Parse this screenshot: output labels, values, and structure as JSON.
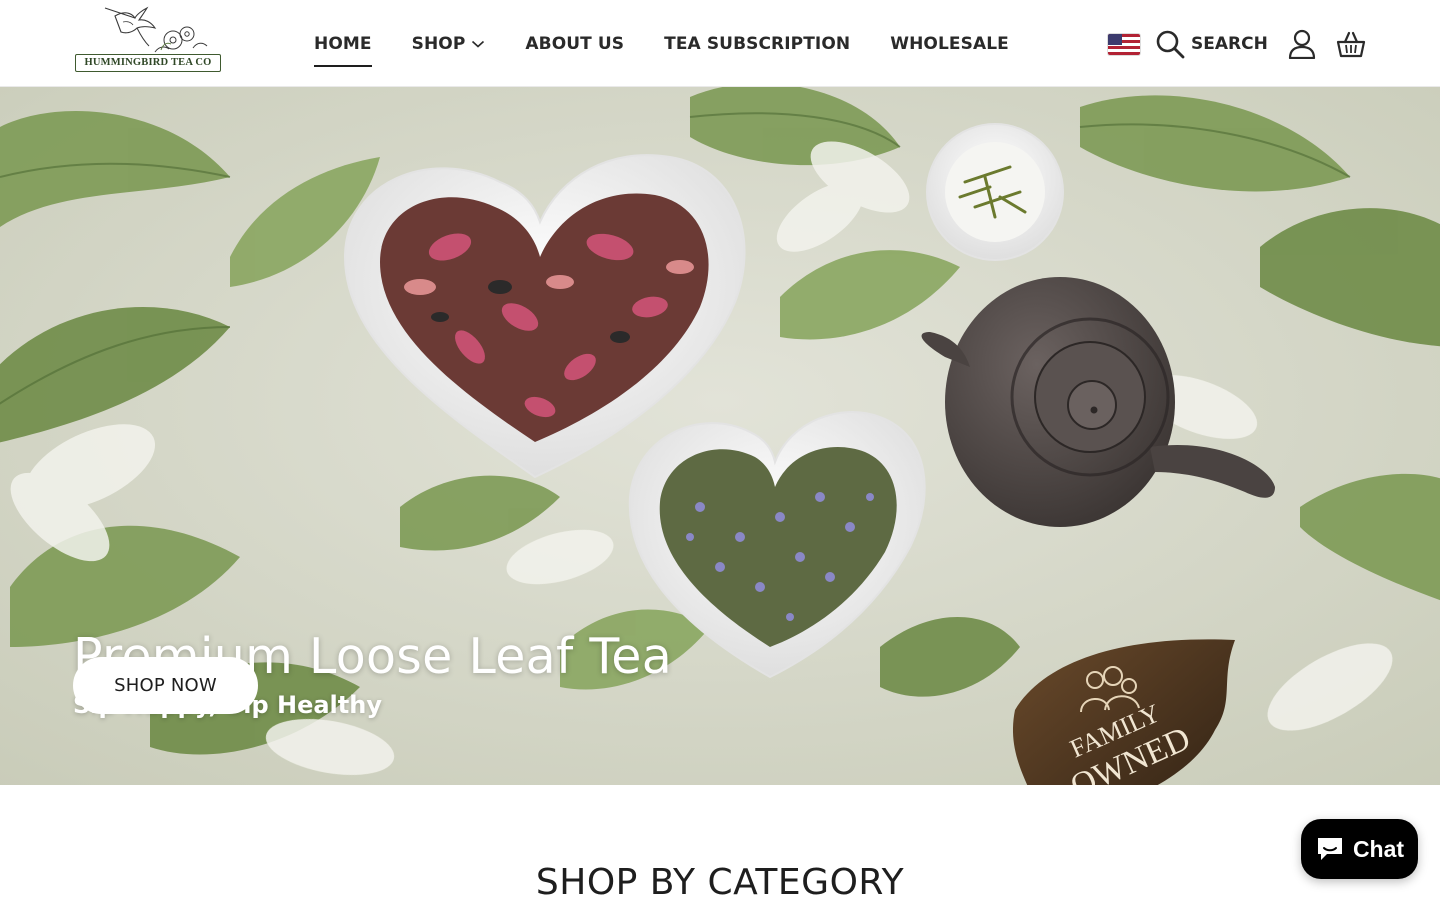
{
  "brand": {
    "name": "HUMMINGBIRD TEA CO",
    "accent": "#3f5a2f"
  },
  "nav": {
    "items": [
      {
        "label": "HOME",
        "active": true
      },
      {
        "label": "SHOP",
        "has_dropdown": true
      },
      {
        "label": "ABOUT US"
      },
      {
        "label": "TEA SUBSCRIPTION"
      },
      {
        "label": "WHOLESALE"
      }
    ]
  },
  "header_actions": {
    "country_flag": "us-flag-icon",
    "search_label": "SEARCH",
    "account_icon": "user-icon",
    "cart_icon": "basket-icon"
  },
  "hero": {
    "title": "Premium Loose Leaf Tea",
    "subtitle": "Sip Happy, Sip Healthy",
    "cta_label": "SHOP NOW",
    "badge_line1": "FAMILY",
    "badge_line2": "OWNED"
  },
  "section": {
    "title": "SHOP BY CATEGORY"
  },
  "chat": {
    "label": "Chat",
    "icon": "chat-bubble-icon",
    "color": "#000000"
  }
}
